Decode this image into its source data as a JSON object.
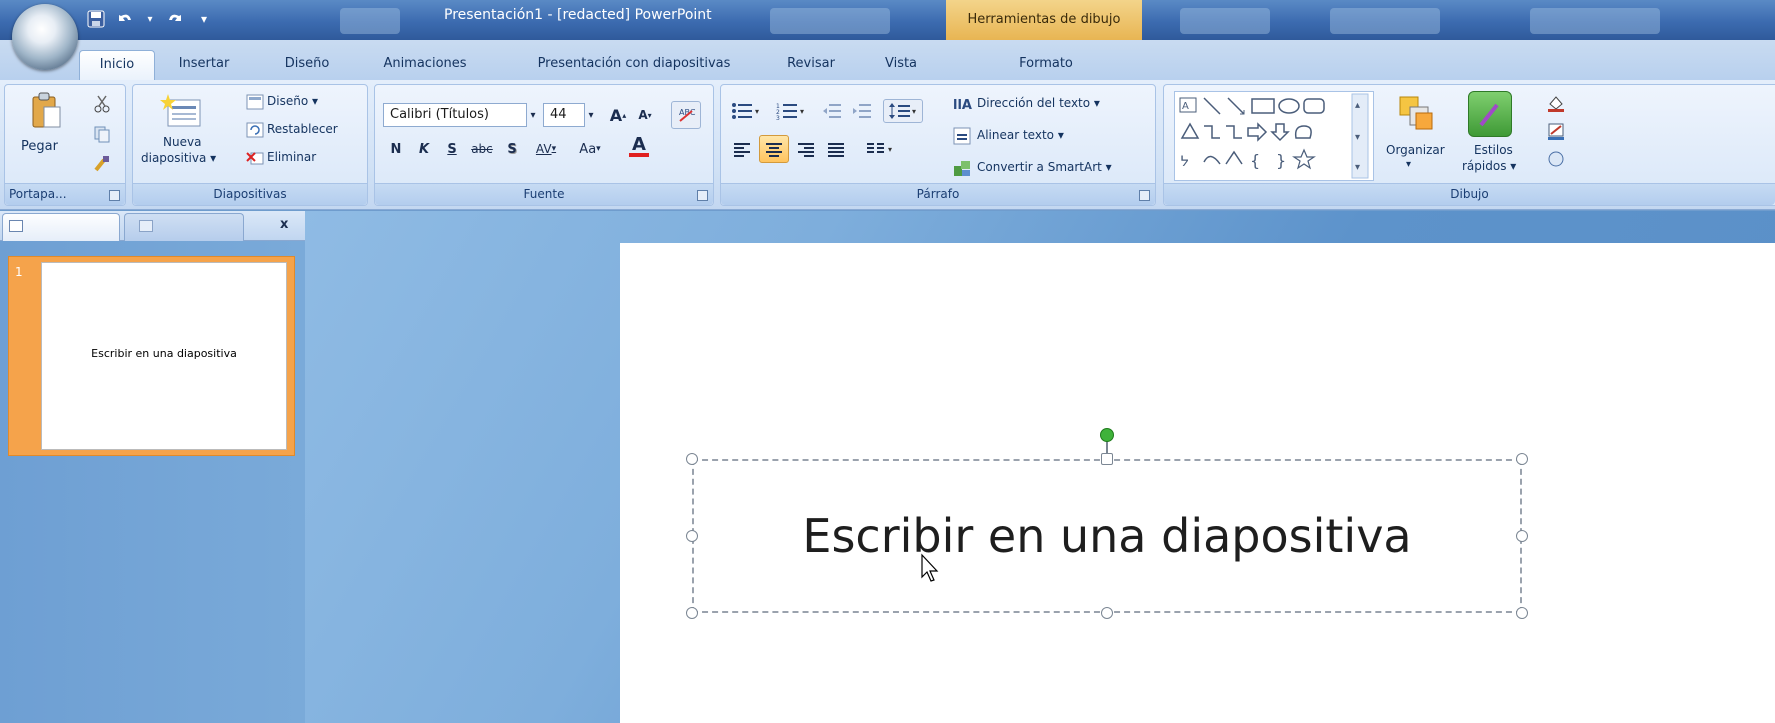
{
  "titlebar": {
    "app_title": "Presentación1 - [redacted] PowerPoint",
    "contextual_title": "Herramientas de dibujo"
  },
  "tabs": [
    {
      "label": "Inicio",
      "active": true
    },
    {
      "label": "Insertar"
    },
    {
      "label": "Diseño"
    },
    {
      "label": "Animaciones"
    },
    {
      "label": "Presentación con diapositivas"
    },
    {
      "label": "Revisar"
    },
    {
      "label": "Vista"
    },
    {
      "label": "Formato"
    }
  ],
  "ribbon": {
    "portapapeles": {
      "paste_label": "Pegar",
      "group_label": "Portapa..."
    },
    "diapositivas": {
      "new_slide_line1": "Nueva",
      "new_slide_line2": "diapositiva",
      "design_label": "Diseño",
      "reset_label": "Restablecer",
      "delete_label": "Eliminar",
      "group_label": "Diapositivas"
    },
    "fuente": {
      "font_name": "Calibri (Títulos)",
      "font_size": "44",
      "bold": "N",
      "italic": "K",
      "underline": "S",
      "strike": "abc",
      "shadow": "S",
      "spacing": "AV",
      "case": "Aa",
      "color": "A",
      "grow": "A",
      "shrink": "A",
      "group_label": "Fuente"
    },
    "parrafo": {
      "text_direction": "Dirección del texto",
      "align_text": "Alinear texto",
      "smartart": "Convertir a SmartArt",
      "group_label": "Párrafo"
    },
    "dibujo": {
      "arrange_label": "Organizar",
      "styles_line1": "Estilos",
      "styles_line2": "rápidos",
      "group_label": "Dibujo"
    }
  },
  "slides_panel": {
    "close_label": "x",
    "slides": [
      {
        "number": "1",
        "title": "Escribir en una diapositiva"
      }
    ]
  },
  "slide": {
    "textbox_text": "Escribir en una diapositiva"
  },
  "colors": {
    "accent_orange": "#f5a34b",
    "rotation_handle": "#3fb23a",
    "font_color_bar": "#e02020"
  }
}
